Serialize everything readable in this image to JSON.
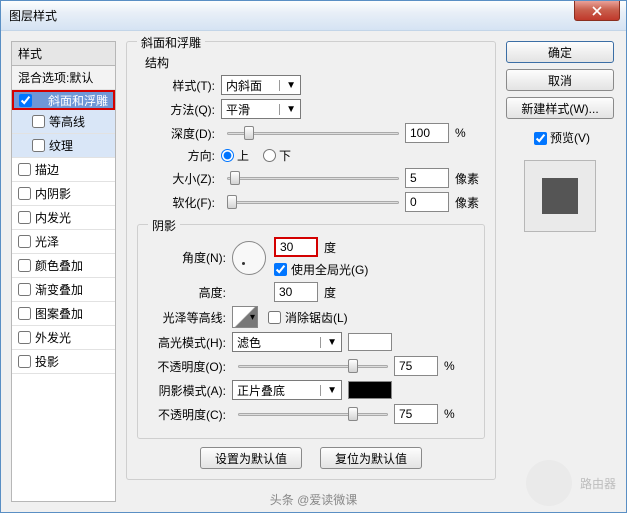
{
  "window": {
    "title": "图层样式"
  },
  "styles": {
    "header": "样式",
    "blend": "混合选项:默认",
    "bevel": "斜面和浮雕",
    "contour": "等高线",
    "texture": "纹理",
    "stroke": "描边",
    "innerShadow": "内阴影",
    "innerGlow": "内发光",
    "satin": "光泽",
    "colorOverlay": "颜色叠加",
    "gradientOverlay": "渐变叠加",
    "patternOverlay": "图案叠加",
    "outerGlow": "外发光",
    "dropShadow": "投影"
  },
  "bevel": {
    "group": "斜面和浮雕",
    "structure": "结构",
    "styleLbl": "样式(T):",
    "styleVal": "内斜面",
    "techLbl": "方法(Q):",
    "techVal": "平滑",
    "depthLbl": "深度(D):",
    "depthVal": "100",
    "pct": "%",
    "dirLbl": "方向:",
    "up": "上",
    "down": "下",
    "sizeLbl": "大小(Z):",
    "sizeVal": "5",
    "px": "像素",
    "softLbl": "软化(F):",
    "softVal": "0",
    "shading": "阴影",
    "angleLbl": "角度(N):",
    "angleVal": "30",
    "deg": "度",
    "globalLight": "使用全局光(G)",
    "altLbl": "高度:",
    "altVal": "30",
    "glossLbl": "光泽等高线:",
    "antiAlias": "消除锯齿(L)",
    "hiModeLbl": "高光模式(H):",
    "hiModeVal": "滤色",
    "hiOpLbl": "不透明度(O):",
    "hiOpVal": "75",
    "shModeLbl": "阴影模式(A):",
    "shModeVal": "正片叠底",
    "shOpLbl": "不透明度(C):",
    "shOpVal": "75"
  },
  "buttons": {
    "setDefault": "设置为默认值",
    "resetDefault": "复位为默认值",
    "ok": "确定",
    "cancel": "取消",
    "newStyle": "新建样式(W)...",
    "preview": "预览(V)"
  },
  "colors": {
    "hiSwatch": "#ffffff",
    "shSwatch": "#000000"
  },
  "watermark": {
    "brand": "路由器",
    "source": "头条 @爱读微课"
  },
  "chart_data": null
}
